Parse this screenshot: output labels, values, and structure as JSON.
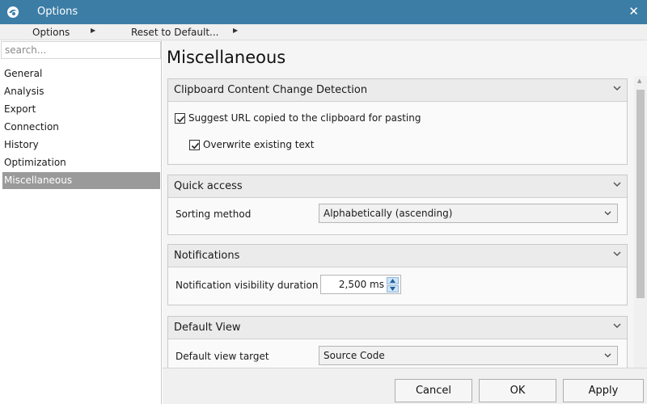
{
  "window": {
    "title": "Options",
    "app_icon": "app-logo-icon",
    "close_icon": "close-icon",
    "close_glyph": "✕"
  },
  "menubar": {
    "options_label": "Options",
    "reset_label": "Reset to Default...",
    "submenu_glyph": "▶"
  },
  "sidebar": {
    "search_placeholder": "search...",
    "items": [
      {
        "label": "General"
      },
      {
        "label": "Analysis"
      },
      {
        "label": "Export"
      },
      {
        "label": "Connection"
      },
      {
        "label": "History"
      },
      {
        "label": "Optimization"
      },
      {
        "label": "Miscellaneous",
        "selected": true
      }
    ]
  },
  "main": {
    "title": "Miscellaneous",
    "sections": {
      "clipboard": {
        "title": "Clipboard Content Change Detection",
        "suggest_url": {
          "label": "Suggest URL copied to the clipboard for pasting",
          "checked": true
        },
        "overwrite": {
          "label": "Overwrite existing text",
          "checked": true
        }
      },
      "quick_access": {
        "title": "Quick access",
        "sorting_label": "Sorting method",
        "sorting_value": "Alphabetically (ascending)"
      },
      "notifications": {
        "title": "Notifications",
        "duration_label": "Notification visibility duration",
        "duration_value": "2,500 ms"
      },
      "default_view": {
        "title": "Default View",
        "target_label": "Default view target",
        "target_value": "Source Code"
      }
    }
  },
  "footer": {
    "cancel_label": "Cancel",
    "ok_label": "OK",
    "apply_label": "Apply"
  },
  "colors": {
    "titlebar": "#3c7da6",
    "selected_item": "#9a9a9a",
    "panel_bg": "#f5f5f5"
  }
}
